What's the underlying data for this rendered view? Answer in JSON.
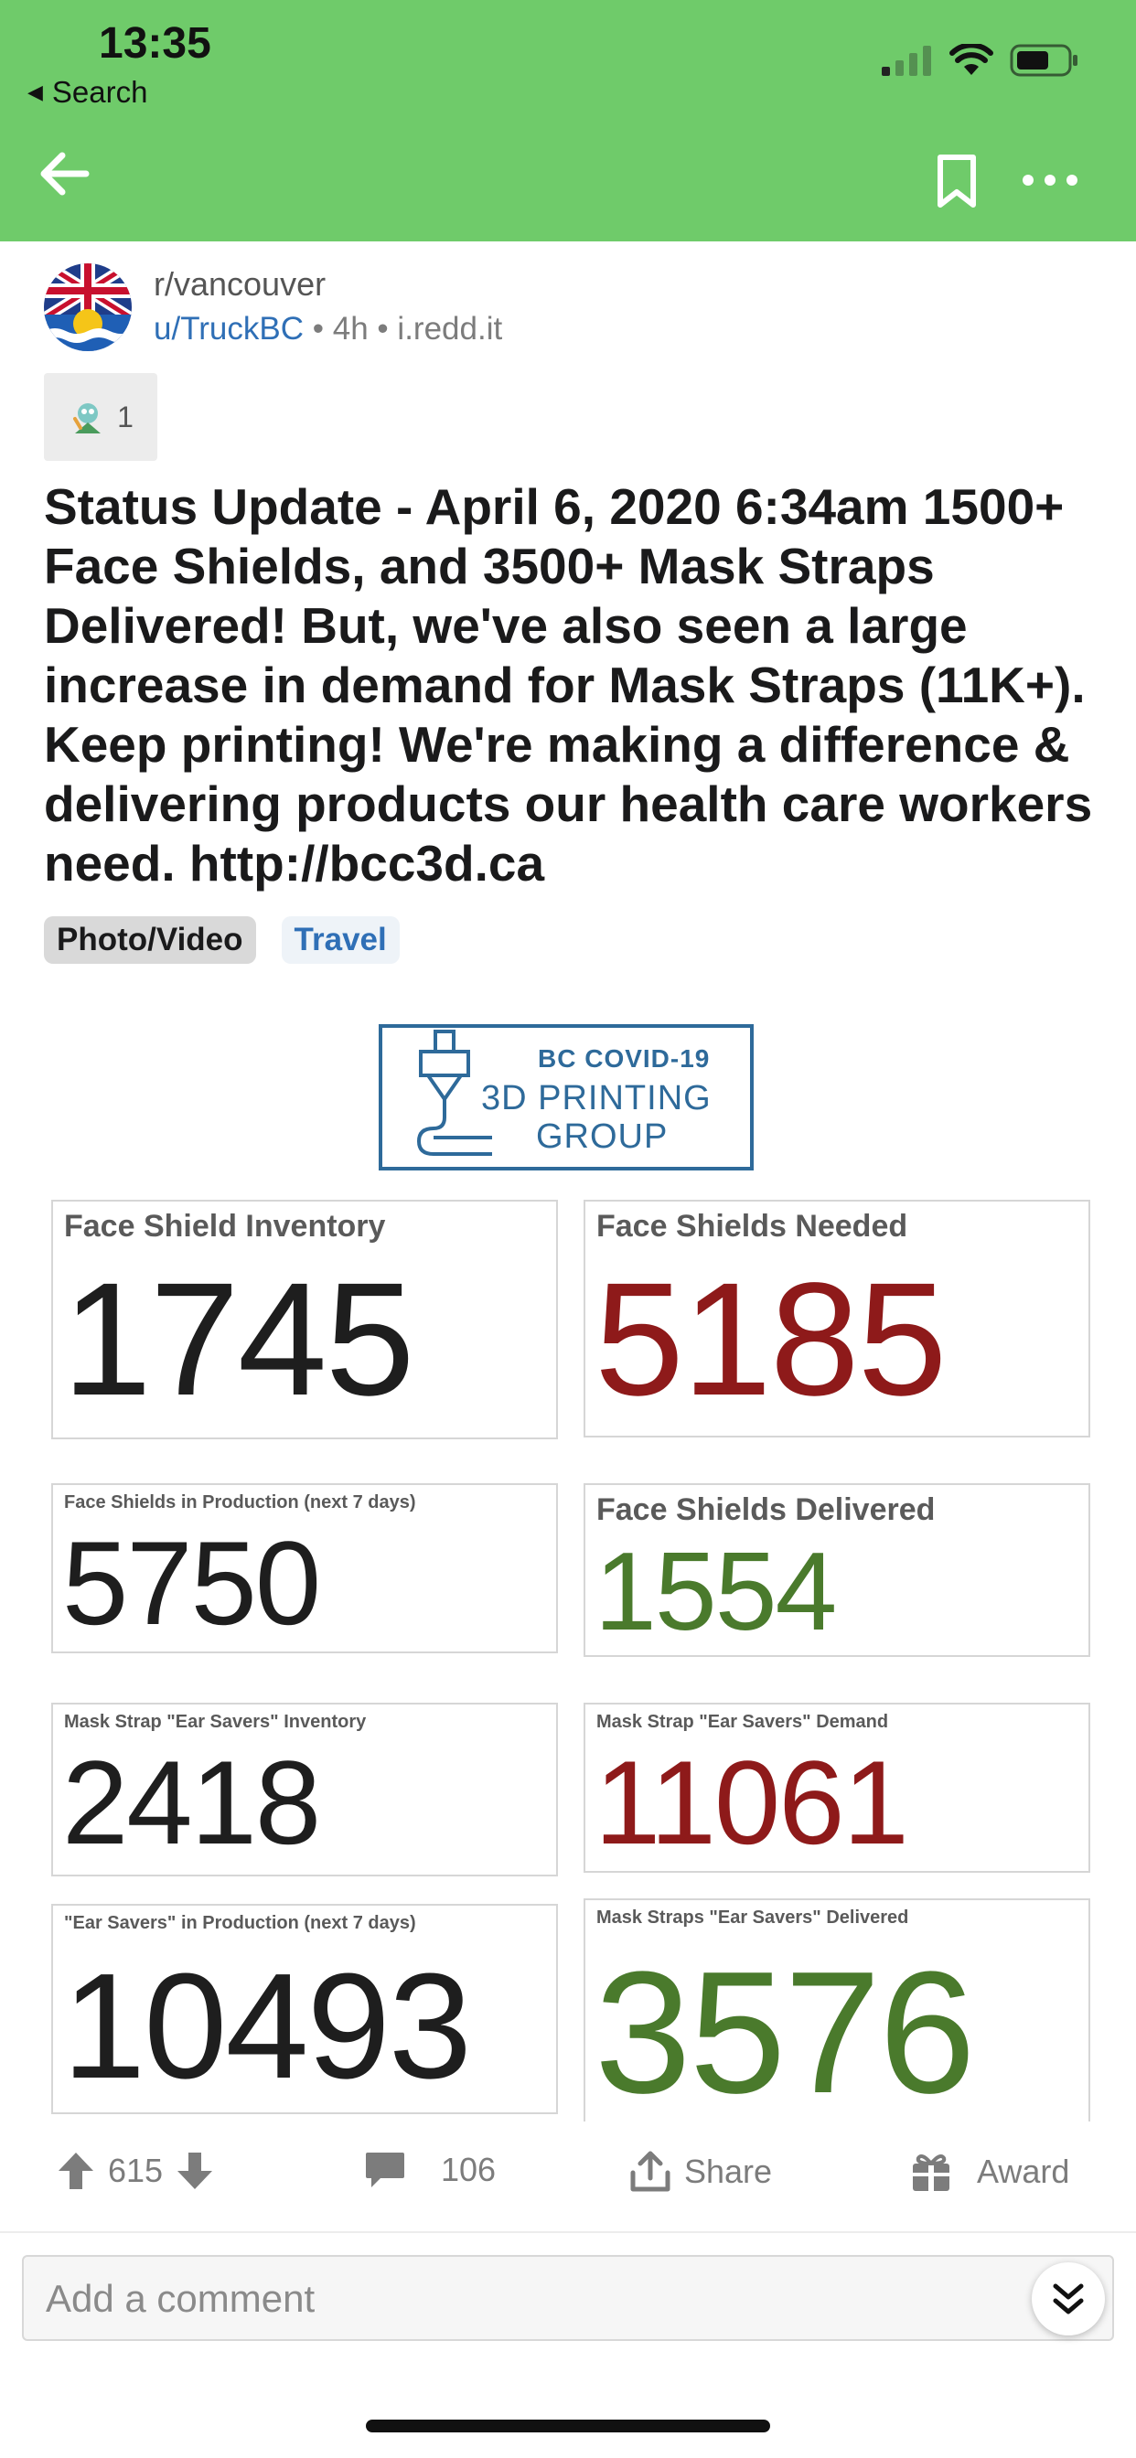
{
  "status_bar": {
    "time": "13:35",
    "back_app": "Search"
  },
  "post": {
    "subreddit": "r/vancouver",
    "user": "u/TruckBC",
    "age": "4h",
    "domain": "i.redd.it",
    "separator": "•",
    "award_count": "1",
    "title": "Status Update - April 6, 2020 6:34am 1500+ Face Shields, and 3500+ Mask Straps Delivered! But, we've also seen a large increase in demand for Mask Straps (11K+). Keep printing! We're making a difference & delivering products our health care workers need. http://bcc3d.ca",
    "flairs": [
      "Photo/Video",
      "Travel"
    ]
  },
  "image": {
    "logo_line1": "BC COVID-19",
    "logo_line2": "3D PRINTING",
    "logo_line3": "GROUP",
    "stats": [
      {
        "label": "Face Shield Inventory",
        "value": "1745",
        "color": "#1e1e1e"
      },
      {
        "label": "Face Shields Needed",
        "value": "5185",
        "color": "#8e1a1a"
      },
      {
        "label": "Face Shields in Production (next 7 days)",
        "value": "5750",
        "color": "#1e1e1e"
      },
      {
        "label": "Face Shields Delivered",
        "value": "1554",
        "color": "#4a7a2c"
      },
      {
        "label": "Mask Strap \"Ear Savers\" Inventory",
        "value": "2418",
        "color": "#1e1e1e"
      },
      {
        "label": "Mask Strap \"Ear Savers\" Demand",
        "value": "11061",
        "color": "#8e1a1a"
      },
      {
        "label": "\"Ear Savers\" in Production (next 7 days)",
        "value": "10493",
        "color": "#1e1e1e"
      },
      {
        "label": "Mask Straps \"Ear Savers\" Delivered",
        "value": "3576",
        "color": "#4a7a2c"
      }
    ]
  },
  "actions": {
    "score": "615",
    "comments": "106",
    "share": "Share",
    "award": "Award"
  },
  "comment": {
    "placeholder": "Add a comment"
  }
}
